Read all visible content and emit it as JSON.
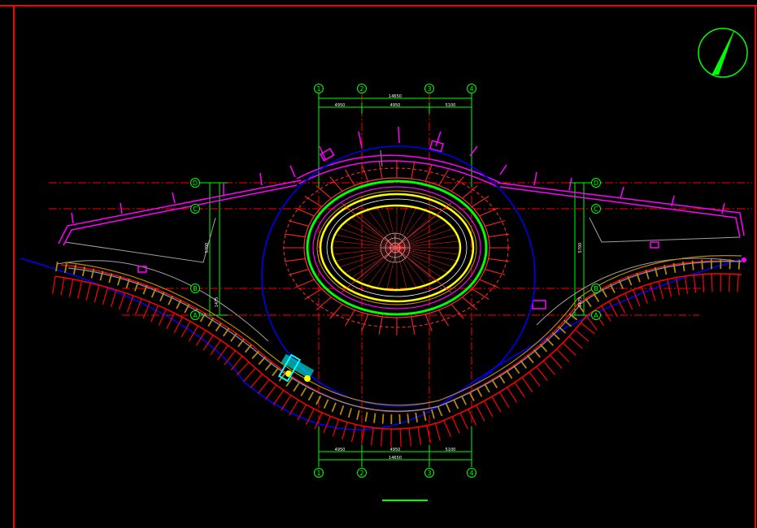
{
  "grid_top": {
    "labels": [
      "1",
      "2",
      "3",
      "4"
    ],
    "overall_dim": "14650",
    "sub_dims": [
      "4950",
      "4950",
      "5100"
    ]
  },
  "grid_bottom": {
    "labels": [
      "1",
      "2",
      "3",
      "4"
    ],
    "overall_dim": "14650",
    "sub_dims": [
      "4950",
      "4950",
      "5100"
    ]
  },
  "grid_left": {
    "labels": [
      "D",
      "C",
      "B",
      "A"
    ],
    "dims": [
      "5700",
      "1475"
    ]
  },
  "grid_right": {
    "labels": [
      "D",
      "C",
      "B",
      "A"
    ],
    "dims": [
      "5700",
      "1475"
    ]
  },
  "colors": {
    "frame": "#ff0000",
    "grid_axis": "#ff0000",
    "dimension": "#00ff00",
    "ring_outer": "#00ff00",
    "ring_inner": "#ffff00",
    "railing": "#ff00ff",
    "stair_treads": "#ff0000",
    "walkway_edge": "#0000ff",
    "wood_joists": "#b8860b"
  },
  "icons": {
    "north_arrow": "north-arrow-icon"
  }
}
